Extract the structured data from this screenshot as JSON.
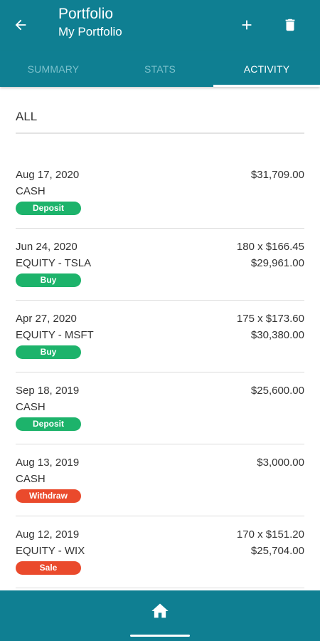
{
  "header": {
    "title": "Portfolio",
    "subtitle": "My Portfolio",
    "back_icon": "arrow-left-icon",
    "add_icon": "plus-icon",
    "delete_icon": "trash-icon"
  },
  "tabs": [
    {
      "label": "SUMMARY",
      "active": false
    },
    {
      "label": "STATS",
      "active": false
    },
    {
      "label": "ACTIVITY",
      "active": true
    }
  ],
  "filter": {
    "label": "ALL"
  },
  "activities": [
    {
      "date": "Aug 17, 2020",
      "asset": "CASH",
      "badge": "Deposit",
      "badge_color": "#1db36b",
      "value1": "$31,709.00",
      "value2": ""
    },
    {
      "date": "Jun 24, 2020",
      "asset": "EQUITY - TSLA",
      "badge": "Buy",
      "badge_color": "#1db36b",
      "value1": "180 x $166.45",
      "value2": "$29,961.00"
    },
    {
      "date": "Apr 27, 2020",
      "asset": "EQUITY - MSFT",
      "badge": "Buy",
      "badge_color": "#1db36b",
      "value1": "175 x $173.60",
      "value2": "$30,380.00"
    },
    {
      "date": "Sep 18, 2019",
      "asset": "CASH",
      "badge": "Deposit",
      "badge_color": "#1db36b",
      "value1": "$25,600.00",
      "value2": ""
    },
    {
      "date": "Aug 13, 2019",
      "asset": "CASH",
      "badge": "Withdraw",
      "badge_color": "#ea4a2c",
      "value1": "$3,000.00",
      "value2": ""
    },
    {
      "date": "Aug 12, 2019",
      "asset": "EQUITY - WIX",
      "badge": "Sale",
      "badge_color": "#ea4a2c",
      "value1": "170 x $151.20",
      "value2": "$25,704.00"
    }
  ],
  "bottom_nav": {
    "home_icon": "home-icon"
  },
  "colors": {
    "primary": "#0f7f92",
    "positive": "#1db36b",
    "negative": "#ea4a2c"
  }
}
